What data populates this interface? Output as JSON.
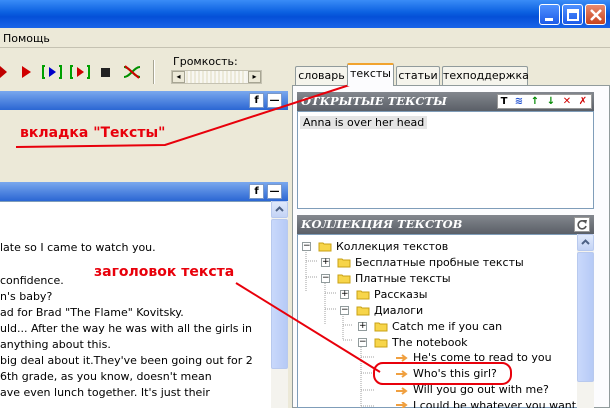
{
  "menu": {
    "help": "Помощь"
  },
  "toolbar": {
    "volume_label": "Громкость:"
  },
  "tabs": [
    {
      "label": "словарь"
    },
    {
      "label": "тексты"
    },
    {
      "label": "статьи"
    },
    {
      "label": "техподдержка"
    }
  ],
  "left_panel": {
    "header_buttons": [
      "f",
      "—"
    ],
    "text_lines": [
      "late so I came to watch you.",
      "",
      "confidence.",
      "n's baby?",
      "ad for Brad \"The Flame\" Kovitsky.",
      "uld... After the way he was with all the girls in",
      "anything about this.",
      "big deal about it.They've been going out for 2",
      "6th grade, as you know, doesn't mean",
      "ave even lunch together. It's just their"
    ]
  },
  "open_texts": {
    "title": "ОТКРЫТЫЕ ТЕКСТЫ",
    "icons": [
      "T",
      "≋",
      "↑",
      "↓",
      "✕",
      "✗"
    ],
    "items": [
      "Anna is over her head"
    ]
  },
  "collection": {
    "title": "КОЛЛЕКЦИЯ ТЕКСТОВ",
    "tree": {
      "root": "Коллекция текстов",
      "free": "Бесплатные пробные тексты",
      "paid": "Платные тексты",
      "stories": "Рассказы",
      "dialogs": "Диалоги",
      "catch": "Catch me if you can",
      "notebook": "The notebook",
      "t1": "He's come to read to you",
      "t2": "Who's this girl?",
      "t3": "Will you go out with me?",
      "t4": "I could be whatever you want"
    }
  },
  "annotations": {
    "tab_label": "вкладка \"Тексты\"",
    "title_label": "заголовок текста"
  },
  "colors": {
    "annotation": "#e8000b",
    "active_tab": "#f1a32e"
  }
}
